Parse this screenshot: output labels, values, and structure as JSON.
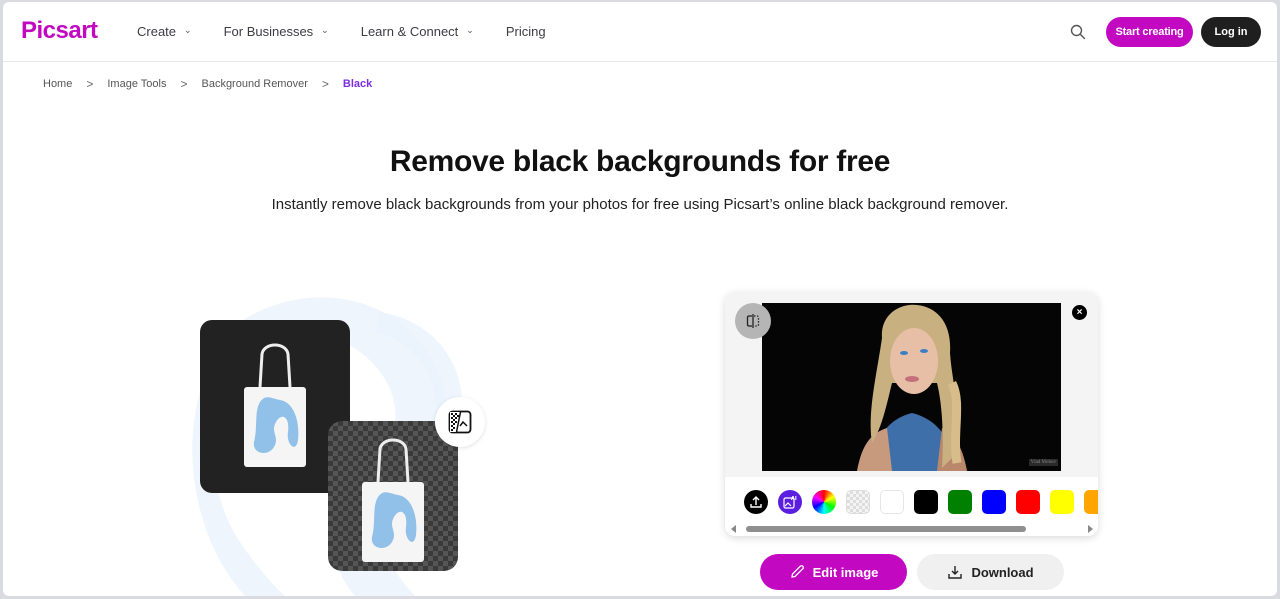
{
  "header": {
    "logo": "Picsart",
    "nav": [
      {
        "label": "Create",
        "has_dropdown": true
      },
      {
        "label": "For Businesses",
        "has_dropdown": true
      },
      {
        "label": "Learn & Connect",
        "has_dropdown": true
      },
      {
        "label": "Pricing",
        "has_dropdown": false
      }
    ],
    "search_icon": "search-icon",
    "start_creating": "Start creating",
    "login": "Log in"
  },
  "breadcrumb": [
    {
      "label": "Home"
    },
    {
      "label": "Image Tools"
    },
    {
      "label": "Background Remover"
    },
    {
      "label": "Black",
      "active": true
    }
  ],
  "hero": {
    "title": "Remove black backgrounds for free",
    "subtitle": "Instantly remove black backgrounds from your photos for free using Picsart’s online black background remover."
  },
  "editor": {
    "photo_watermark": "Vlad Mohov",
    "close_label": "×",
    "palette": [
      {
        "name": "upload",
        "type": "icon",
        "color": "#000000"
      },
      {
        "name": "ai-background",
        "type": "icon",
        "color": "#5b1ee0"
      },
      {
        "name": "color-wheel",
        "type": "icon",
        "color": "rainbow"
      },
      {
        "name": "transparent",
        "type": "swatch",
        "color": "transparent"
      },
      {
        "name": "white",
        "type": "swatch",
        "color": "#ffffff"
      },
      {
        "name": "black",
        "type": "swatch",
        "color": "#000000"
      },
      {
        "name": "green",
        "type": "swatch",
        "color": "#008000"
      },
      {
        "name": "blue",
        "type": "swatch",
        "color": "#0000ff"
      },
      {
        "name": "red",
        "type": "swatch",
        "color": "#ff0000"
      },
      {
        "name": "yellow",
        "type": "swatch",
        "color": "#ffff00"
      },
      {
        "name": "orange",
        "type": "swatch",
        "color": "#ffa500"
      }
    ]
  },
  "actions": {
    "edit_image": "Edit image",
    "download": "Download"
  },
  "colors": {
    "brand": "#c209c1",
    "breadcrumb_active": "#7a2fe0",
    "login_bg": "#1f1f1f"
  }
}
